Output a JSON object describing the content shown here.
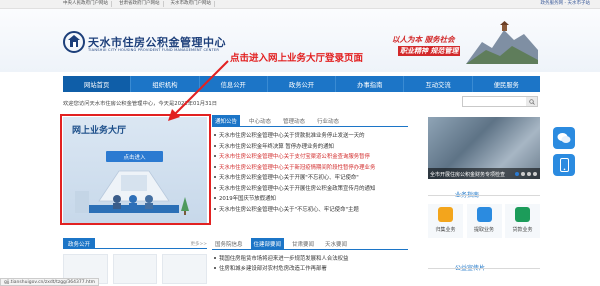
{
  "top_links": [
    "中央人民政府门户网站",
    "甘肃省政府门户网站",
    "天水市政府门户网站"
  ],
  "top_right": "政务服务网 - 天水市子站",
  "logo": {
    "cn": "天水市住房公积金管理中心",
    "en": "TIANSHUI CITY HOUSING PROVIDENT FUND MANAGEMENT CENTER"
  },
  "slogan": {
    "line1": "以人为本  服务社会",
    "line2": "职业精神  规范管理"
  },
  "nav": [
    "网站首页",
    "组织机构",
    "信息公开",
    "政务公开",
    "办事指南",
    "互动交流",
    "便民服务"
  ],
  "welcome": "欢迎您访问天水市住房公积金管理中心，今天是2022年01月31日",
  "banner": {
    "title": "网上业务大厅",
    "enter": "点击进入"
  },
  "annotation": "点击进入网上业务大厅登录页面",
  "news_tabs": [
    "通知公告",
    "中心动态",
    "管理动态",
    "行业动态"
  ],
  "news": [
    {
      "text": "天水市住房公积金管理中心关于贷款批准业务停止发送一天的",
      "red": false
    },
    {
      "text": "天水市住房公积金年终决算 暂停办理业务的通知",
      "red": false
    },
    {
      "text": "天水市住房公积金管理中心关于支付宝渠道公积金查询服务暂停",
      "red": true
    },
    {
      "text": "天水市住房公积金管理中心关于新冠疫情期间阶段性暂停办理业务",
      "red": true
    },
    {
      "text": "天水市住房公积金管理中心关于开展\"不忘初心、牢记使命\"",
      "red": false
    },
    {
      "text": "天水市住房公积金管理中心关于开展住房公积金政策宣传月的通知",
      "red": false
    },
    {
      "text": "2019年国庆节放假通知",
      "red": false
    },
    {
      "text": "天水市住房公积金管理中心关于\"不忘初心、牢记使命\"主题",
      "red": false
    }
  ],
  "photo_caption": "全市开展住房公积金财务专项检查",
  "guide_title": "业务指南",
  "guide": [
    {
      "label": "归集业务",
      "color": "#f3a51c"
    },
    {
      "label": "提取业务",
      "color": "#2b8be0"
    },
    {
      "label": "贷款业务",
      "color": "#1c9c5a"
    }
  ],
  "zwgk_title": "政务公开",
  "zwgk_more": "更多>>",
  "tabs2": [
    "国务院信息",
    "住建部要闻",
    "甘肃要闻",
    "天水要闻"
  ],
  "news2": [
    "我国住房租赁市场将迎来进一步规范发展和人合法权益",
    "住房和城乡建设部对农村危房改造工作再部署"
  ],
  "public_title": "公益宣传片",
  "status_url": "gjj.tianshuigov.cn/zxdt/tzgg/364377.htm"
}
